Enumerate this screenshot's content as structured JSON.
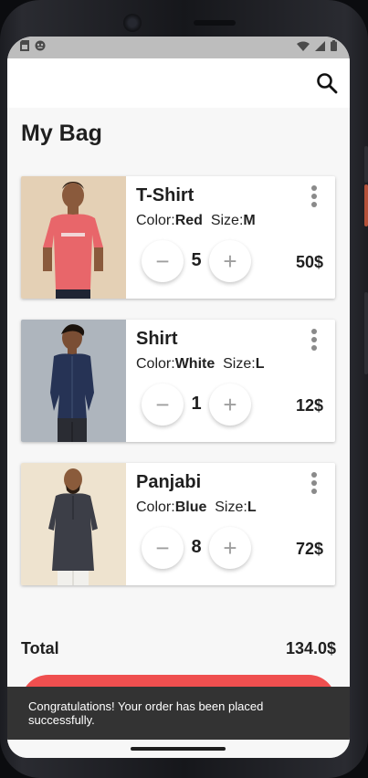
{
  "page": {
    "title": "My Bag"
  },
  "cart": {
    "items": [
      {
        "name": "T-Shirt",
        "color_label": "Color:",
        "color": "Red",
        "size_label": "Size:",
        "size": "M",
        "quantity": "5",
        "price": "50$",
        "thumb_bg": "#e9d8bf",
        "garment_color": "#e8666a"
      },
      {
        "name": "Shirt",
        "color_label": "Color:",
        "color": "White",
        "size_label": "Size:",
        "size": "L",
        "quantity": "1",
        "price": "12$",
        "thumb_bg": "#aeb5bd",
        "garment_color": "#263355"
      },
      {
        "name": "Panjabi",
        "color_label": "Color:",
        "color": "Blue",
        "size_label": "Size:",
        "size": "L",
        "quantity": "8",
        "price": "72$",
        "thumb_bg": "#eee3cf",
        "garment_color": "#3c3e47"
      }
    ],
    "minus_symbol": "−",
    "plus_symbol": "+"
  },
  "summary": {
    "total_label": "Total",
    "total_value": "134.0$"
  },
  "snackbar": {
    "message": "Congratulations! Your order has been placed successfully."
  },
  "icons": {
    "search": "search-icon",
    "more": "more-vert-icon",
    "status": [
      "sim-icon",
      "notification-icon",
      "wifi-icon",
      "signal-icon",
      "battery-icon"
    ]
  },
  "colors": {
    "accent": "#ef4f4f",
    "status_bar": "#bdbdbd",
    "snackbar": "#333333",
    "background": "#f7f7f7"
  }
}
